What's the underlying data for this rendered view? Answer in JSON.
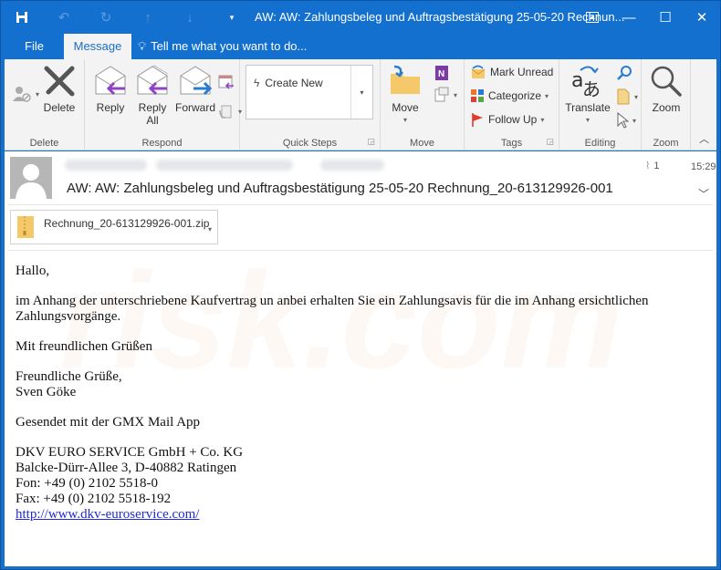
{
  "window": {
    "title": "AW: AW: Zahlungsbeleg und Auftragsbestätigung 25-05-20 Rechnun...",
    "qat": {
      "save_icon": "floppy-disk-icon",
      "undo_icon": "undo-icon",
      "redo_icon": "redo-icon",
      "prev_icon": "up-arrow-icon",
      "next_icon": "down-arrow-icon",
      "customize_icon": "dropdown-icon"
    },
    "controls": {
      "ribbon_display": "ribbon-display-options-icon",
      "minimize": "—",
      "maximize": "☐",
      "close": "✕"
    }
  },
  "tabs": {
    "file": "File",
    "message": "Message",
    "tell_me": "Tell me what you want to do..."
  },
  "ribbon": {
    "delete_group": {
      "label": "Delete",
      "delete": "Delete"
    },
    "respond_group": {
      "label": "Respond",
      "reply": "Reply",
      "reply_all_line1": "Reply",
      "reply_all_line2": "All",
      "forward": "Forward"
    },
    "quick_steps_group": {
      "label": "Quick Steps",
      "create_new": "Create New"
    },
    "move_group": {
      "label": "Move",
      "move": "Move"
    },
    "tags_group": {
      "label": "Tags",
      "mark_unread": "Mark Unread",
      "categorize": "Categorize",
      "follow_up": "Follow Up"
    },
    "editing_group": {
      "label": "Editing",
      "translate": "Translate"
    },
    "zoom_group": {
      "label": "Zoom",
      "zoom": "Zoom"
    }
  },
  "message": {
    "attachment_count": "1",
    "time": "15:29",
    "subject": "AW: AW: Zahlungsbeleg und Auftragsbestätigung 25-05-20 Rechnung_20-613129926-001",
    "attachment": {
      "filename": "Rechnung_20-613129926-001.zip"
    },
    "body": {
      "greeting": "Hallo,",
      "paragraph": "im Anhang der unterschriebene Kaufvertrag un anbei erhalten Sie ein Zahlungsavis für die im Anhang ersichtlichen Zahlungsvorgänge.",
      "closing1": "Mit freundlichen Grüßen",
      "closing2": "Freundliche Grüße,",
      "name": "Sven Göke",
      "sent_with": "Gesendet mit der GMX Mail App",
      "company": "DKV EURO SERVICE GmbH + Co. KG",
      "address": "Balcke-Dürr-Allee 3, D-40882 Ratingen",
      "phone": "Fon: +49 (0) 2102 5518-0",
      "fax": "Fax: +49 (0) 2102 5518-192",
      "link": "http://www.dkv-euroservice.com/"
    }
  },
  "colors": {
    "titlebar": "#1470cf",
    "ribbon": "#f3f3f3",
    "reply_arrow": "#8e44c4",
    "forward_arrow": "#2a7bd0",
    "folder": "#f5c96a",
    "link": "#1f2bd6"
  }
}
